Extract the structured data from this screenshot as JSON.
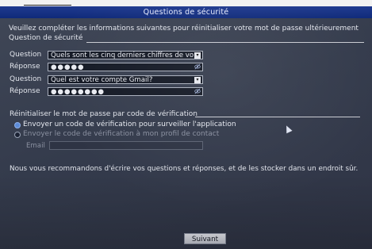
{
  "window": {
    "title": "Questions de sécurité"
  },
  "intro": "Veuillez compléter les informations suivantes pour réinitialiser votre mot de passe ultérieurement",
  "security_section": {
    "legend": "Question de sécurité",
    "rows": [
      {
        "label": "Question",
        "value": "Quels sont les cinq derniers chiffres de vo",
        "type": "select"
      },
      {
        "label": "Réponse",
        "value": "●●●●●",
        "type": "password"
      },
      {
        "label": "Question",
        "value": "Quel est votre compte Gmail?",
        "type": "select"
      },
      {
        "label": "Réponse",
        "value": "●●●●●●●●",
        "type": "password"
      }
    ]
  },
  "reset_section": {
    "legend": "Réinitialiser le mot de passe par code de vérification",
    "options": [
      {
        "label": "Envoyer un code de vérification pour surveiller l'application",
        "selected": true
      },
      {
        "label": "Envoyer le code de vérification à mon profil de contact",
        "selected": false
      }
    ],
    "email_label": "Email",
    "email_value": ""
  },
  "recommendation": "Nous vous recommandons d'écrire vos questions et réponses, et de les stocker dans un endroit sûr.",
  "buttons": {
    "next": "Suivant"
  },
  "icons": {
    "dropdown": "▾",
    "reveal": "eye-icon"
  },
  "colors": {
    "titlebar": "#1f3a8f",
    "panel": "#343b4c",
    "radio_selected": "#5c8bd8"
  }
}
